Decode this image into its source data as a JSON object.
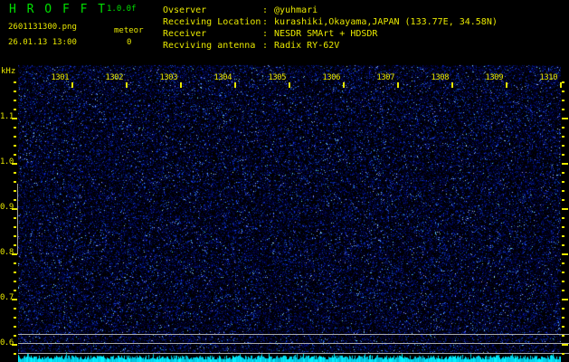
{
  "header": {
    "title": "H R O F F T",
    "version": "1.0.0f",
    "filename": "2601131300.png",
    "mode_label": "meteor",
    "meteor_count": "0",
    "datetime": "26.01.13 13:00",
    "separator": ":",
    "info_rows": [
      {
        "label": "Ovserver",
        "value": "@yuhmari"
      },
      {
        "label": "Receiving Location",
        "value": "kurashiki,Okayama,JAPAN (133.77E, 34.58N)"
      },
      {
        "label": "Receiver",
        "value": "NESDR SMArt + HDSDR"
      },
      {
        "label": "Recviving antenna",
        "value": "Radix RY-62V"
      }
    ]
  },
  "chart_data": {
    "type": "heatmap",
    "subtype": "radio-meteor-spectrogram",
    "title": "HROFFT 1.0.0f spectrogram 26.01.13 13:00",
    "ylabel": "kHz",
    "xtick_labels": [
      "1301",
      "1302",
      "1303",
      "1304",
      "1305",
      "1306",
      "1307",
      "1308",
      "1309",
      "1310"
    ],
    "ytick_labels": [
      "1.1",
      "1.0",
      "0.9",
      "0.8",
      "0.7",
      "0.6"
    ],
    "ytick_values_khz": [
      1.1,
      1.0,
      0.9,
      0.8,
      0.7,
      0.6
    ],
    "ylim_khz": [
      0.58,
      1.22
    ],
    "x_span_minutes": [
      "13:00",
      "13:10"
    ],
    "grid": false,
    "legend_position": "none",
    "series": [],
    "content_note": "uniform dark-blue background noise only; meteor echo count shown is 0",
    "reference_lines_khz": [
      0.62,
      0.6,
      0.58
    ],
    "left_marker_segment_khz": [
      0.95,
      0.8
    ],
    "bottom_strip": "cyan signal-level bars along full time axis"
  },
  "colors": {
    "background": "#000000",
    "title_green": "#00e000",
    "label_yellow": "#e8e800",
    "noise_blue": "#0030c0",
    "level_cyan": "#00e8e8",
    "ref_line_gray": "#aaaaaa"
  }
}
